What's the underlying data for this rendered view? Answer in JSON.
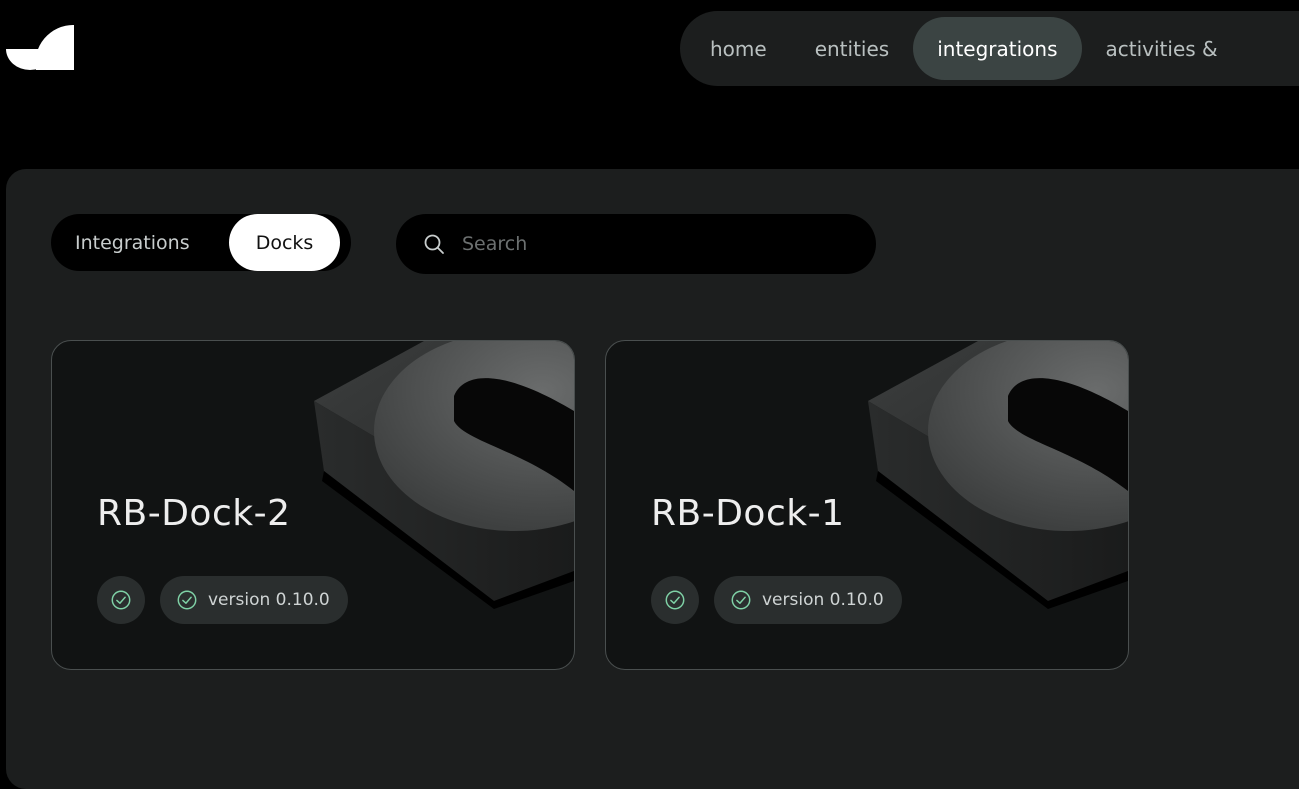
{
  "nav": {
    "items": [
      {
        "label": "home",
        "active": false
      },
      {
        "label": "entities",
        "active": false
      },
      {
        "label": "integrations",
        "active": true
      },
      {
        "label": "activities &",
        "active": false
      }
    ]
  },
  "toggle": {
    "integrations_label": "Integrations",
    "docks_label": "Docks",
    "selected": "Docks"
  },
  "search": {
    "placeholder": "Search",
    "icon": "search-icon"
  },
  "docks": [
    {
      "name": "RB-Dock-2",
      "status_icon": "check-circle-icon",
      "version": "version 0.10.0"
    },
    {
      "name": "RB-Dock-1",
      "status_icon": "check-circle-icon",
      "version": "version 0.10.0"
    }
  ],
  "colors": {
    "background": "#000000",
    "panel": "#1c1e1e",
    "nav_active": "#3b4443",
    "status_ok": "#7fd1a6"
  }
}
